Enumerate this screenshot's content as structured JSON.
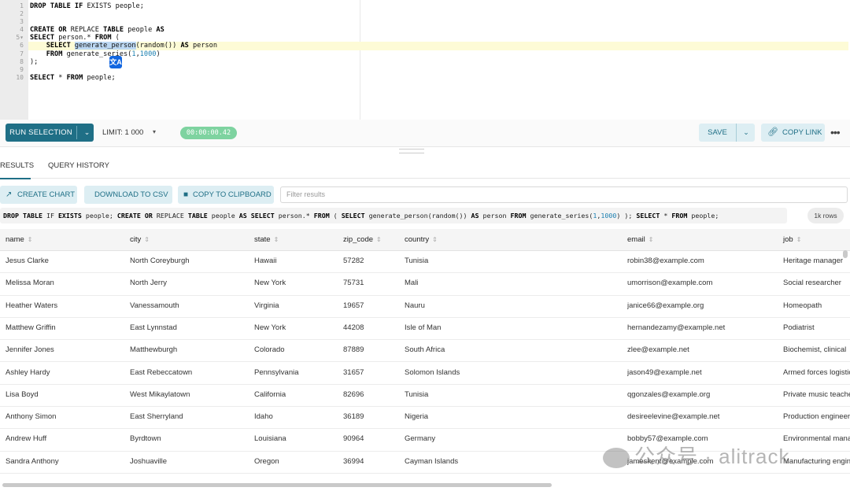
{
  "editor": {
    "line_numbers": [
      "1",
      "2",
      "3",
      "4",
      "5",
      "6",
      "7",
      "8",
      "9",
      "10"
    ],
    "fold_marker": "▾",
    "translate_badge": "文A"
  },
  "toolbar": {
    "run_label": "RUN SELECTION",
    "limit_label": "LIMIT:",
    "limit_value": "1 000",
    "elapsed": "00:00:00.42",
    "save_label": "SAVE",
    "copy_link_label": "COPY LINK",
    "more": "•••"
  },
  "tabs": [
    {
      "label": "RESULTS",
      "active": true
    },
    {
      "label": "QUERY HISTORY",
      "active": false
    }
  ],
  "actions": {
    "create_chart": "CREATE CHART",
    "download_csv": "DOWNLOAD TO CSV",
    "copy_clipboard": "COPY TO CLIPBOARD",
    "filter_placeholder": "Filter results"
  },
  "row_count": "1k rows",
  "columns": [
    "name",
    "city",
    "state",
    "zip_code",
    "country",
    "email",
    "job"
  ],
  "rows": [
    [
      "Jesus Clarke",
      "North Coreyburgh",
      "Hawaii",
      "57282",
      "Tunisia",
      "robin38@example.com",
      "Heritage manager"
    ],
    [
      "Melissa Moran",
      "North Jerry",
      "New York",
      "75731",
      "Mali",
      "umorrison@example.com",
      "Social researcher"
    ],
    [
      "Heather Waters",
      "Vanessamouth",
      "Virginia",
      "19657",
      "Nauru",
      "janice66@example.org",
      "Homeopath"
    ],
    [
      "Matthew Griffin",
      "East Lynnstad",
      "New York",
      "44208",
      "Isle of Man",
      "hernandezamy@example.net",
      "Podiatrist"
    ],
    [
      "Jennifer Jones",
      "Matthewburgh",
      "Colorado",
      "87889",
      "South Africa",
      "zlee@example.net",
      "Biochemist, clinical"
    ],
    [
      "Ashley Hardy",
      "East Rebeccatown",
      "Pennsylvania",
      "31657",
      "Solomon Islands",
      "jason49@example.net",
      "Armed forces logistics"
    ],
    [
      "Lisa Boyd",
      "West Mikaylatown",
      "California",
      "82696",
      "Tunisia",
      "qgonzales@example.org",
      "Private music teacher"
    ],
    [
      "Anthony Simon",
      "East Sherryland",
      "Idaho",
      "36189",
      "Nigeria",
      "desireelevine@example.net",
      "Production engineer"
    ],
    [
      "Andrew Huff",
      "Byrdtown",
      "Louisiana",
      "90964",
      "Germany",
      "bobby57@example.com",
      "Environmental manager"
    ],
    [
      "Sandra Anthony",
      "Joshuaville",
      "Oregon",
      "36994",
      "Cayman Islands",
      "jameskent@example.com",
      "Manufacturing engineer"
    ]
  ],
  "watermark": "公众号 · alitrack",
  "colors": {
    "accent": "#1f6f86",
    "accent_light": "#ddeef3",
    "timer": "#7ed3a0",
    "current_line": "#fdfbd6"
  }
}
